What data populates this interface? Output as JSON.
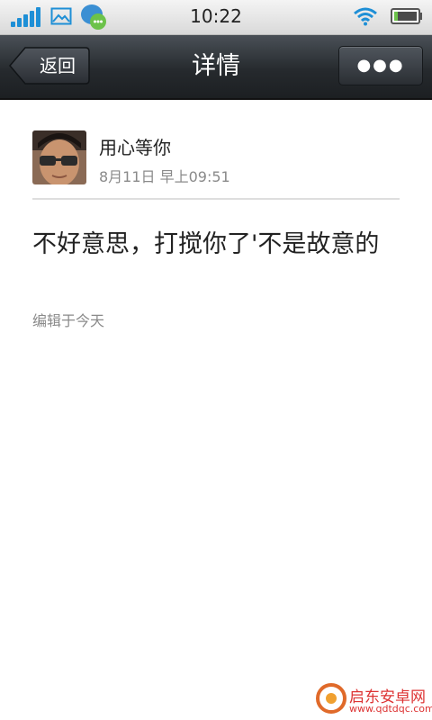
{
  "status_bar": {
    "time": "10:22",
    "icons": [
      "signal-icon",
      "gallery-icon",
      "chat-bubble-icon",
      "wifi-icon",
      "battery-icon"
    ]
  },
  "title_bar": {
    "back_label": "返回",
    "title": "详情",
    "more_label": "●●●"
  },
  "post": {
    "user_name": "用心等你",
    "time": "8月11日 早上09:51",
    "message": "不好意思，打搅你了'不是故意的",
    "edit_note": "编辑于今天"
  },
  "watermark": {
    "text": "启东安卓网",
    "url": "www.qdtdqc.com"
  },
  "colors": {
    "title_bar": "#262a2e",
    "accent": "#1e8fd6",
    "secondary_text": "#8a8a8a"
  }
}
